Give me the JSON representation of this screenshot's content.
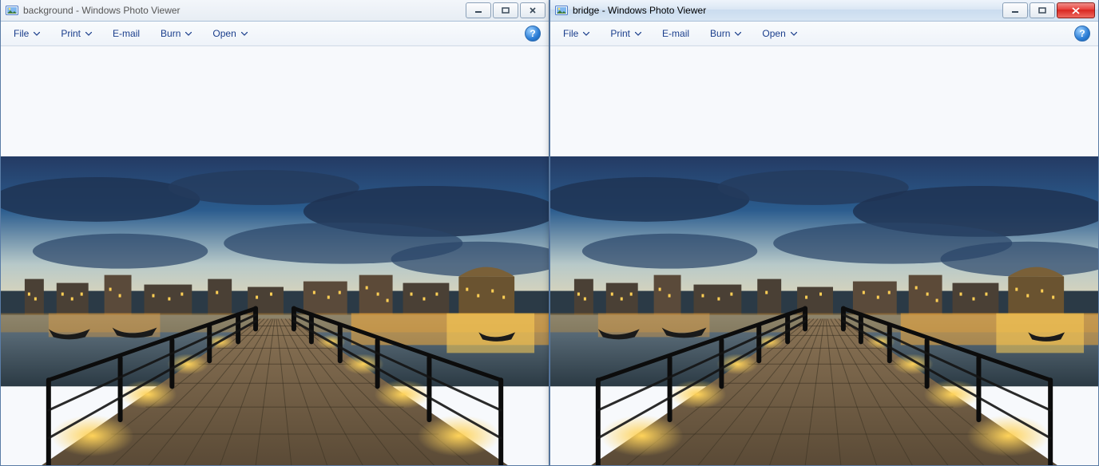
{
  "windows": [
    {
      "id": "left",
      "title": "background - Windows Photo Viewer",
      "active": false,
      "close_style": "normal"
    },
    {
      "id": "right",
      "title": "bridge - Windows Photo Viewer",
      "active": true,
      "close_style": "active"
    }
  ],
  "menu": {
    "items": [
      {
        "label": "File",
        "has_dropdown": true
      },
      {
        "label": "Print",
        "has_dropdown": true
      },
      {
        "label": "E-mail",
        "has_dropdown": false
      },
      {
        "label": "Burn",
        "has_dropdown": true
      },
      {
        "label": "Open",
        "has_dropdown": true
      }
    ],
    "help_symbol": "?"
  }
}
